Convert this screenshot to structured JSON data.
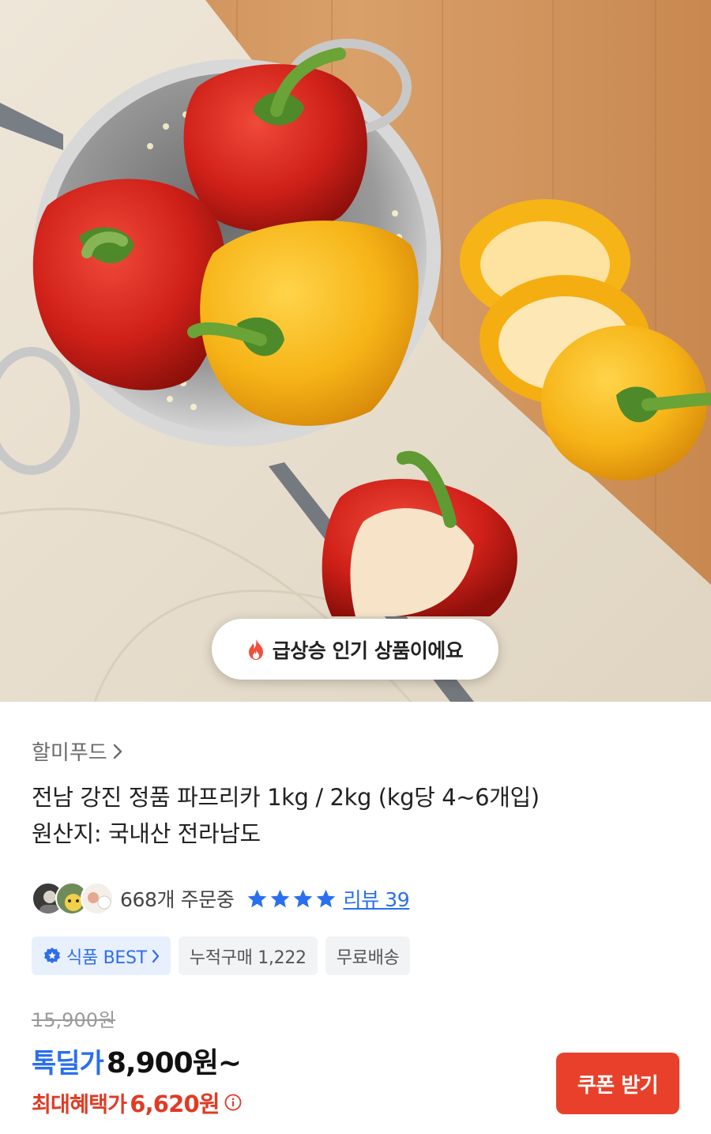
{
  "hero": {
    "image_alt": "red and yellow bell peppers in a steel colander",
    "trend_badge": {
      "icon": "flame-icon",
      "text": "급상승 인기 상품이에요"
    }
  },
  "product": {
    "seller": "할미푸드",
    "title_line1": "전남 강진 정품 파프리카 1kg / 2kg (kg당 4~6개입)",
    "title_line2": "원산지: 국내산 전라남도",
    "orders": "668개 주문중",
    "rating_stars": 4,
    "review_link": "리뷰 39",
    "chips": {
      "best": "식품 BEST",
      "cumulative": "누적구매 1,222",
      "shipping": "무료배송"
    },
    "original_price": "15,900원",
    "deal_label": "톡딜가",
    "deal_price": "8,900원~",
    "max_benefit_label": "최대혜택가",
    "max_benefit_price": "6,620원",
    "coupon_button": "쿠폰 받기"
  },
  "colors": {
    "accent_blue": "#2a6ff0",
    "accent_red": "#e8402a",
    "benefit_red": "#e03b24"
  }
}
